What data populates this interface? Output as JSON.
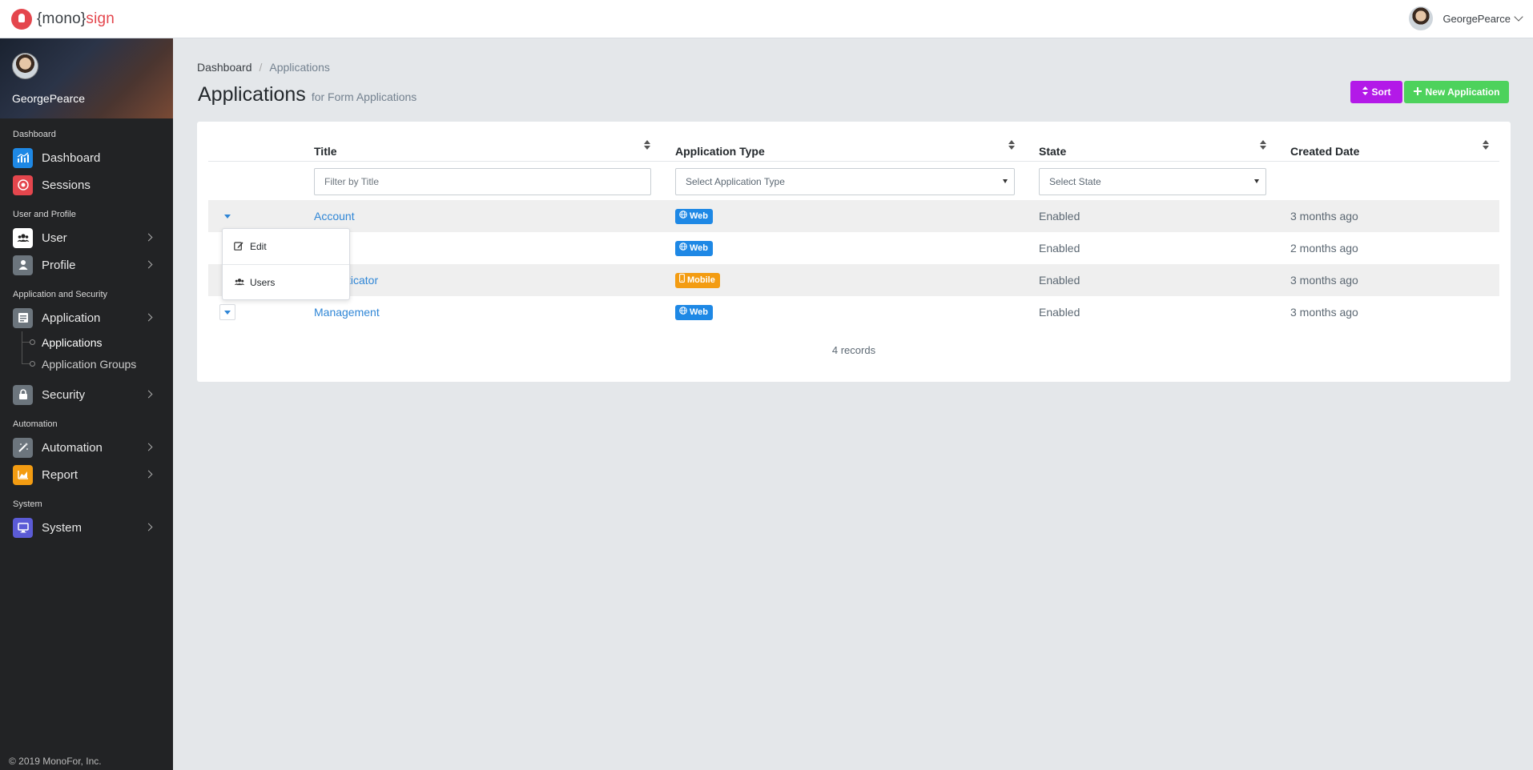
{
  "app": {
    "logo_prefix": "{mono}",
    "logo_suffix": "sign",
    "user_name": "GeorgePearce"
  },
  "sidebar": {
    "profile_name": "GeorgePearce",
    "sections": [
      {
        "title": "Dashboard",
        "items": [
          {
            "label": "Dashboard",
            "icon": "chart-icon",
            "color": "#1e88e5",
            "chevron": false
          },
          {
            "label": "Sessions",
            "icon": "record-icon",
            "color": "#e4464d",
            "chevron": false
          }
        ]
      },
      {
        "title": "User and Profile",
        "items": [
          {
            "label": "User",
            "icon": "users-icon",
            "color": "#ffffff",
            "chevron": true
          },
          {
            "label": "Profile",
            "icon": "person-icon",
            "color": "#6c757d",
            "chevron": true
          }
        ]
      },
      {
        "title": "Application and Security",
        "items": [
          {
            "label": "Application",
            "icon": "window-icon",
            "color": "#6c757d",
            "chevron": true
          }
        ]
      },
      {
        "title": "Automation",
        "items": [
          {
            "label": "Automation",
            "icon": "magic-wand-icon",
            "color": "#6c757d",
            "chevron": true
          },
          {
            "label": "Report",
            "icon": "bar-chart-icon",
            "color": "#f39c12",
            "chevron": true
          }
        ]
      },
      {
        "title": "System",
        "items": [
          {
            "label": "System",
            "icon": "monitor-icon",
            "color": "#5b5bd6",
            "chevron": true
          }
        ]
      }
    ],
    "application_subitems": [
      "Applications",
      "Application Groups"
    ],
    "security_label": "Security",
    "footer": "© 2019 MonoFor, Inc."
  },
  "breadcrumb": {
    "home": "Dashboard",
    "current": "Applications"
  },
  "page": {
    "title": "Applications",
    "subtitle": "for Form Applications"
  },
  "toolbar": {
    "sort_label": "Sort",
    "new_label": "New Application"
  },
  "table": {
    "columns": [
      "Title",
      "Application Type",
      "State",
      "Created Date"
    ],
    "filters": {
      "title_placeholder": "Filter by Title",
      "type_placeholder": "Select Application Type",
      "state_placeholder": "Select State"
    },
    "rows": [
      {
        "title": "Account",
        "type": "Web",
        "state": "Enabled",
        "created": "3 months ago"
      },
      {
        "title": "",
        "type": "Web",
        "state": "Enabled",
        "created": "2 months ago"
      },
      {
        "title": "ticator",
        "type": "Mobile",
        "state": "Enabled",
        "created": "3 months ago"
      },
      {
        "title": "Management",
        "type": "Web",
        "state": "Enabled",
        "created": "3 months ago"
      }
    ],
    "records": "4 records"
  },
  "popup": {
    "edit_label": "Edit",
    "users_label": "Users"
  },
  "colors": {
    "accent": "#2f86d6",
    "sort_button": "#b319e8",
    "new_button": "#4dd25c",
    "web_badge": "#1e88e5",
    "mobile_badge": "#f39c12",
    "sidebar_bg": "#222325"
  }
}
